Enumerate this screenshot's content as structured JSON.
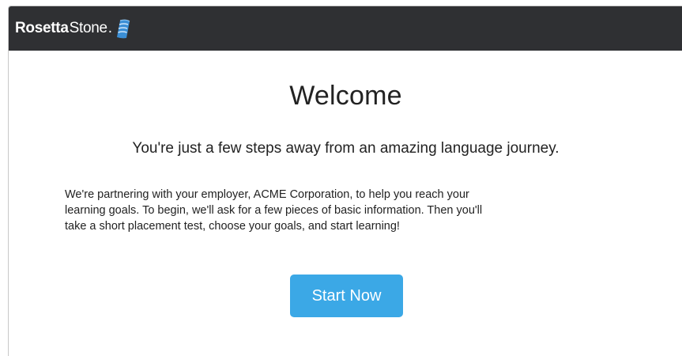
{
  "header": {
    "logo_bold": "Rosetta",
    "logo_light": "Stone",
    "logo_dot": ".",
    "logo_icon": "rosetta-stone-logo-icon",
    "bar_color": "#2f3033"
  },
  "main": {
    "title": "Welcome",
    "subtitle": "You're just a few steps away from an amazing language journey.",
    "paragraph_lines": [
      "We're partnering with your employer, ACME Corporation, to help you reach your",
      "learning goals. To begin, we'll ask for a few pieces of basic information. Then you'll",
      "take a short placement test, choose your goals, and start learning!"
    ],
    "start_button_label": "Start Now",
    "accent_color": "#3ba8e6"
  }
}
